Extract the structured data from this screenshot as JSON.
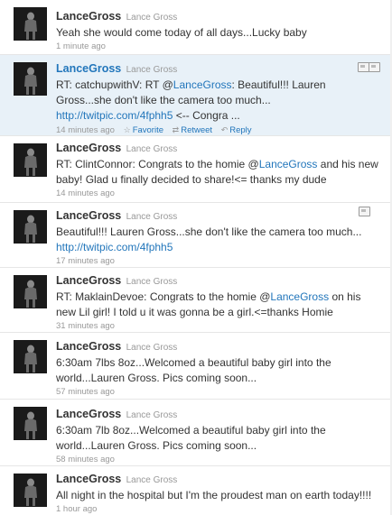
{
  "timeline": {
    "tweets": [
      {
        "screen_name": "LanceGross",
        "full_name": "Lance Gross",
        "text_parts": [
          "Yeah she would come today of all days...Lucky baby"
        ],
        "time": "1 minute ago"
      },
      {
        "screen_name": "LanceGross",
        "full_name": "Lance Gross",
        "text_parts": [
          "RT: catchupwithV: RT @",
          "LanceGross",
          ": Beautiful!!! Lauren Gross...she don't like the camera too much... ",
          "http://twitpic.com/4fphh5",
          " <-- Congra ..."
        ],
        "time": "14 minutes ago",
        "actions": {
          "favorite": "Favorite",
          "retweet": "Retweet",
          "reply": "Reply"
        },
        "icons": [
          "media-icon",
          "media-icon"
        ]
      },
      {
        "screen_name": "LanceGross",
        "full_name": "Lance Gross",
        "text_parts": [
          "RT: ClintConnor: Congrats to the homie @",
          "LanceGross",
          " and his new baby! Glad u finally decided to share!<= thanks my dude"
        ],
        "time": "14 minutes ago"
      },
      {
        "screen_name": "LanceGross",
        "full_name": "Lance Gross",
        "text_parts": [
          "Beautiful!!! Lauren Gross...she don't like the camera too much... ",
          "http://twitpic.com/4fphh5"
        ],
        "time": "17 minutes ago",
        "icons": [
          "media-icon"
        ]
      },
      {
        "screen_name": "LanceGross",
        "full_name": "Lance Gross",
        "text_parts": [
          "RT: MaklainDevoe: Congrats to the homie @",
          "LanceGross",
          " on his new Lil girl! I told u it was gonna be a girl.<=thanks Homie"
        ],
        "time": "31 minutes ago"
      },
      {
        "screen_name": "LanceGross",
        "full_name": "Lance Gross",
        "text_parts": [
          "6:30am 7lbs 8oz...Welcomed a beautiful baby girl into the world...Lauren Gross. Pics coming soon..."
        ],
        "time": "57 minutes ago"
      },
      {
        "screen_name": "LanceGross",
        "full_name": "Lance Gross",
        "text_parts": [
          "6:30am 7lb 8oz...Welcomed a beautiful baby girl into the world...Lauren Gross. Pics coming soon..."
        ],
        "time": "58 minutes ago"
      },
      {
        "screen_name": "LanceGross",
        "full_name": "Lance Gross",
        "text_parts": [
          "All night in the hospital but I'm the proudest man on earth today!!!!"
        ],
        "time": "1 hour ago"
      }
    ]
  },
  "colors": {
    "link": "#2276bb",
    "hover_background": "#e8f1f8",
    "meta_gray": "#999999",
    "text": "#333333"
  }
}
